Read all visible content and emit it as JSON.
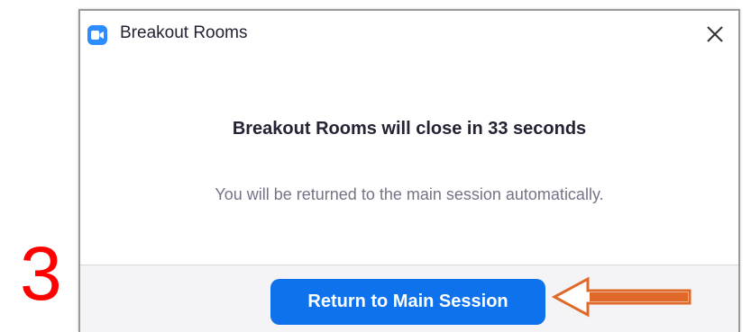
{
  "step": {
    "number": "3",
    "color": "#ff0000"
  },
  "dialog": {
    "title": "Breakout Rooms",
    "app_icon": "zoom-camera-icon",
    "close_icon": "close-icon",
    "headline": "Breakout Rooms will close in 33 seconds",
    "subtext": "You will be returned to the main session automatically.",
    "primary_button": {
      "label": "Return to Main Session",
      "color": "#0e72ed"
    }
  },
  "annotation": {
    "icon": "left-arrow-icon",
    "color": "#e0692a"
  }
}
